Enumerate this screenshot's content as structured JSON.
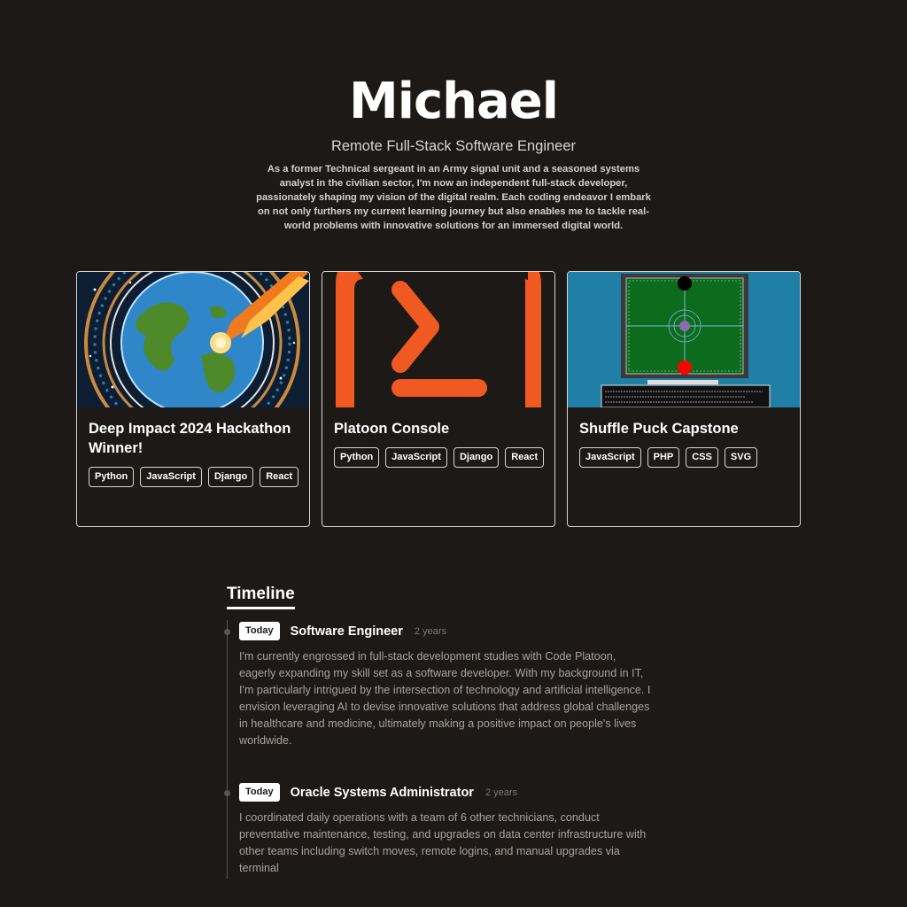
{
  "hero": {
    "name": "Michael",
    "role": "Remote Full-Stack Software Engineer",
    "bio": "As a former Technical sergeant in an Army signal unit and a seasoned systems analyst in the civilian sector, I'm now an independent full-stack developer, passionately shaping my vision of the digital realm. Each coding endeavor I embark on not only furthers my current learning journey but also enables me to tackle real-world problems with innovative solutions for an immersed digital world."
  },
  "projects": [
    {
      "title": "Deep Impact 2024 Hackathon Winner!",
      "tags": [
        "Python",
        "JavaScript",
        "Django",
        "React"
      ]
    },
    {
      "title": "Platoon Console",
      "tags": [
        "Python",
        "JavaScript",
        "Django",
        "React"
      ]
    },
    {
      "title": "Shuffle Puck Capstone",
      "tags": [
        "JavaScript",
        "PHP",
        "CSS",
        "SVG"
      ]
    }
  ],
  "timeline": {
    "heading": "Timeline",
    "items": [
      {
        "badge": "Today",
        "title": "Software Engineer",
        "duration": "2 years",
        "description": "I'm currently engrossed in full-stack development studies with Code Platoon, eagerly expanding my skill set as a software developer. With my background in IT, I'm particularly intrigued by the intersection of technology and artificial intelligence. I envision leveraging AI to devise innovative solutions that address global challenges in healthcare and medicine, ultimately making a positive impact on people's lives worldwide."
      },
      {
        "badge": "Today",
        "title": "Oracle Systems Administrator",
        "duration": "2 years",
        "description": "I coordinated daily operations with a team of 6 other technicians, conduct preventative maintenance, testing, and upgrades on data center infrastructure with other teams including switch moves, remote logins, and manual upgrades via terminal"
      }
    ]
  },
  "colors": {
    "background": "#1d1917",
    "text": "#ffffff",
    "muted": "#a9a39e",
    "console_orange": "#f05a22",
    "puck_table_green": "#0d6b1e",
    "puck_bg_blue": "#1f7fa6"
  },
  "icons": {
    "card1": "earth-meteor-illustration",
    "card2": "terminal-prompt-logo",
    "card3": "air-hockey-game-screenshot"
  }
}
